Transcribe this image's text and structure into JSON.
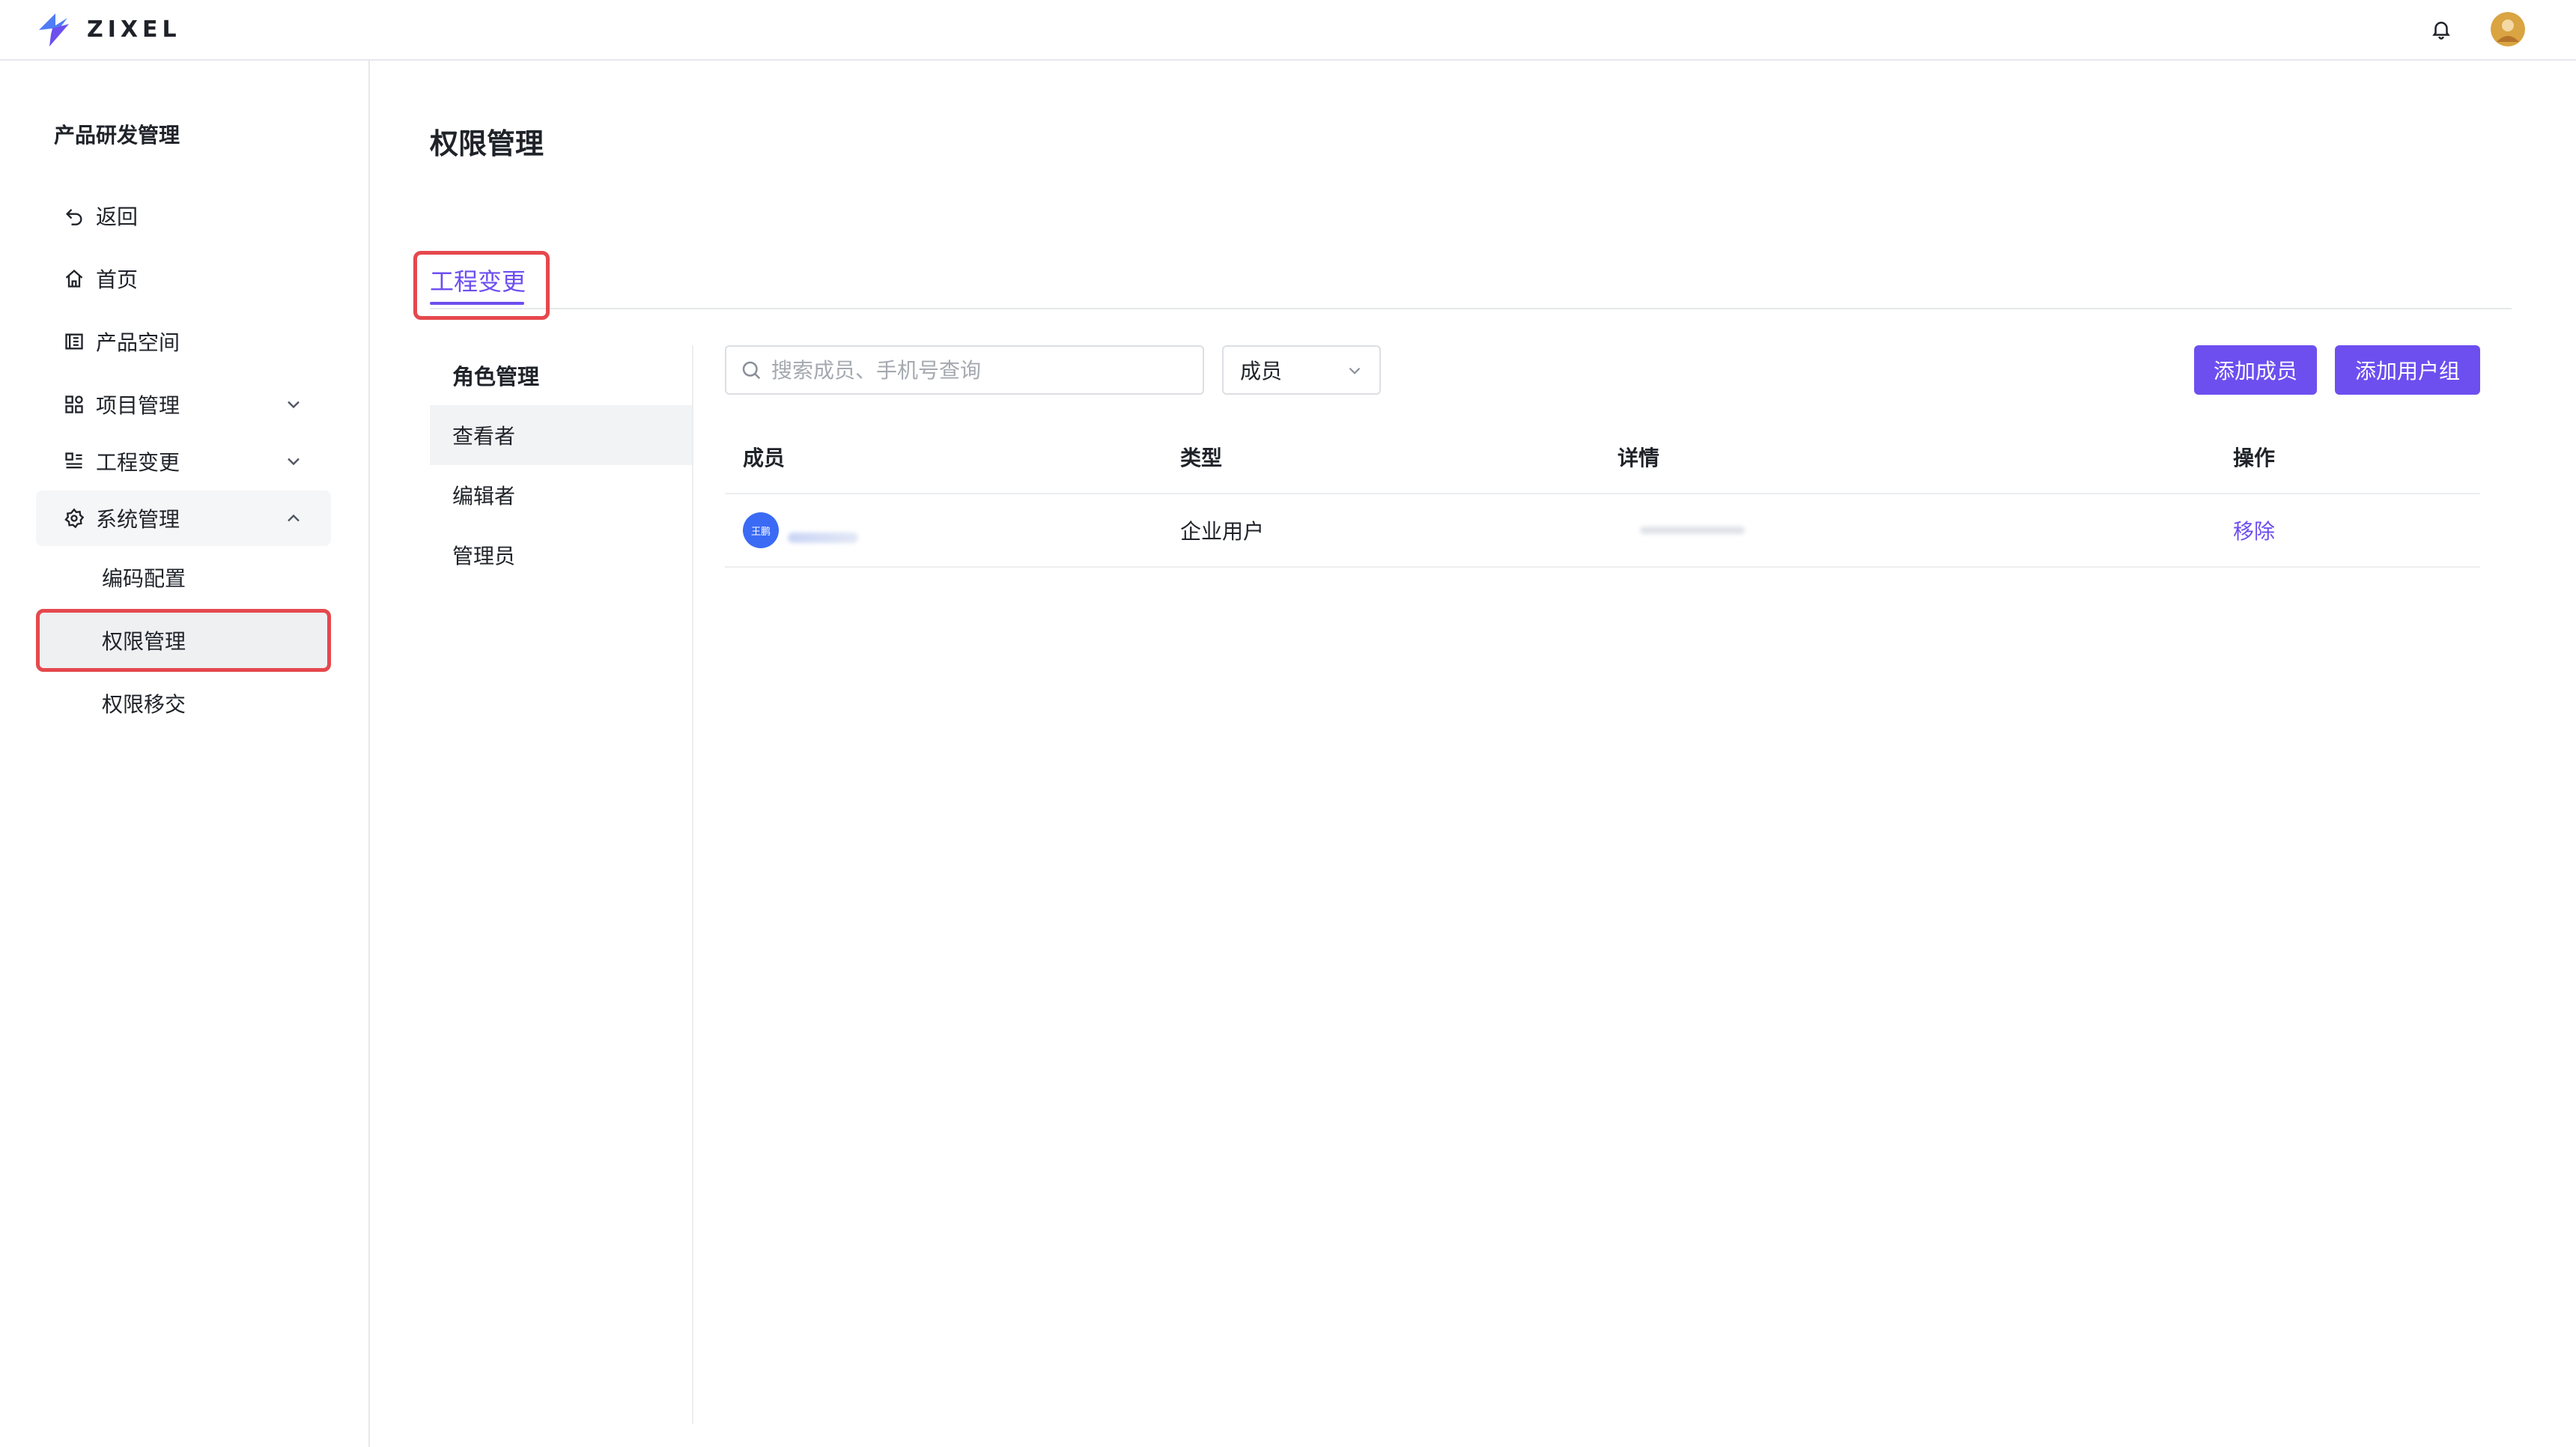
{
  "app": {
    "logo_text": "ZIXEL"
  },
  "colors": {
    "accent": "#6d4fef",
    "avatar_blue": "#3b6bf5",
    "highlight_red": "#e5484d"
  },
  "header": {
    "icons": [
      "bell-icon",
      "user-avatar"
    ]
  },
  "sidebar": {
    "title": "产品研发管理",
    "items": [
      {
        "label": "返回",
        "icon": "back-icon"
      },
      {
        "label": "首页",
        "icon": "home-icon"
      },
      {
        "label": "产品空间",
        "icon": "product-space-icon"
      },
      {
        "label": "项目管理",
        "icon": "grid-icon",
        "expandable": true,
        "expanded": false
      },
      {
        "label": "工程变更",
        "icon": "list-icon",
        "expandable": true,
        "expanded": false
      },
      {
        "label": "系统管理",
        "icon": "gear-icon",
        "expandable": true,
        "expanded": true
      }
    ],
    "sub_items": [
      {
        "label": "编码配置",
        "active": false
      },
      {
        "label": "权限管理",
        "active": true
      },
      {
        "label": "权限移交",
        "active": false
      }
    ]
  },
  "main": {
    "page_title": "权限管理",
    "tabs": [
      {
        "label": "工程变更",
        "active": true
      }
    ],
    "roles": {
      "title": "角色管理",
      "items": [
        {
          "label": "查看者",
          "selected": true
        },
        {
          "label": "编辑者",
          "selected": false
        },
        {
          "label": "管理员",
          "selected": false
        }
      ]
    },
    "toolbar": {
      "search_placeholder": "搜索成员、手机号查询",
      "filter_value": "成员",
      "add_member_label": "添加成员",
      "add_group_label": "添加用户组"
    },
    "table": {
      "columns": [
        "成员",
        "类型",
        "详情",
        "操作"
      ],
      "rows": [
        {
          "avatar_text": "王鹏",
          "type": "企业用户",
          "action": "移除"
        }
      ]
    }
  }
}
